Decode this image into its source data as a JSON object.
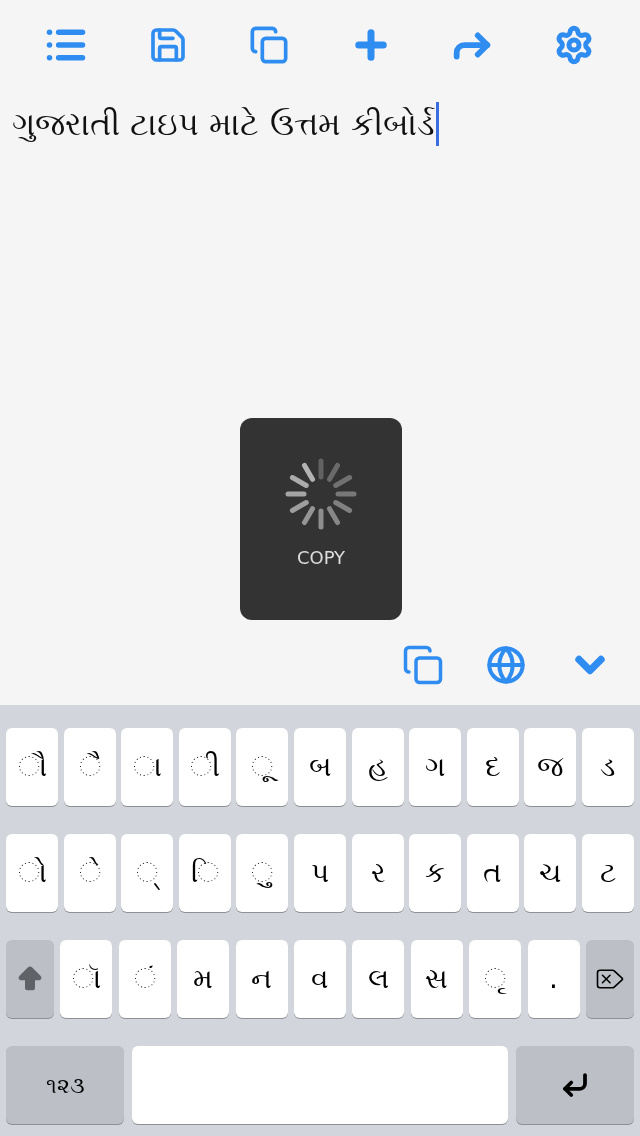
{
  "editor": {
    "value": "ગુજરાતી ટાઇપ માટે ઉત્તમ કીબોર્ડ"
  },
  "toast": {
    "label": "COPY"
  },
  "keyboard": {
    "rows": [
      [
        {
          "kind": "char",
          "label": "ૌ"
        },
        {
          "kind": "char",
          "label": "ૈ"
        },
        {
          "kind": "char",
          "label": "ા"
        },
        {
          "kind": "char",
          "label": "ી"
        },
        {
          "kind": "char",
          "label": "ૂ"
        },
        {
          "kind": "char",
          "label": "બ"
        },
        {
          "kind": "char",
          "label": "હ"
        },
        {
          "kind": "char",
          "label": "ગ"
        },
        {
          "kind": "char",
          "label": "દ"
        },
        {
          "kind": "char",
          "label": "જ"
        },
        {
          "kind": "char",
          "label": "ડ"
        }
      ],
      [
        {
          "kind": "char",
          "label": "ો"
        },
        {
          "kind": "char",
          "label": "ે"
        },
        {
          "kind": "char",
          "label": "્"
        },
        {
          "kind": "char",
          "label": "િ"
        },
        {
          "kind": "char",
          "label": "ુ"
        },
        {
          "kind": "char",
          "label": "પ"
        },
        {
          "kind": "char",
          "label": "ર"
        },
        {
          "kind": "char",
          "label": "ક"
        },
        {
          "kind": "char",
          "label": "ત"
        },
        {
          "kind": "char",
          "label": "ચ"
        },
        {
          "kind": "char",
          "label": "ટ"
        }
      ],
      [
        {
          "kind": "shift"
        },
        {
          "kind": "char",
          "label": "ૉ"
        },
        {
          "kind": "char",
          "label": "ં"
        },
        {
          "kind": "char",
          "label": "મ"
        },
        {
          "kind": "char",
          "label": "ન"
        },
        {
          "kind": "char",
          "label": "વ"
        },
        {
          "kind": "char",
          "label": "લ"
        },
        {
          "kind": "char",
          "label": "સ"
        },
        {
          "kind": "char",
          "label": "ૃ"
        },
        {
          "kind": "char",
          "label": "."
        },
        {
          "kind": "backspace"
        }
      ],
      [
        {
          "kind": "numbers",
          "label": "૧૨૩"
        },
        {
          "kind": "space"
        },
        {
          "kind": "return"
        }
      ]
    ]
  }
}
